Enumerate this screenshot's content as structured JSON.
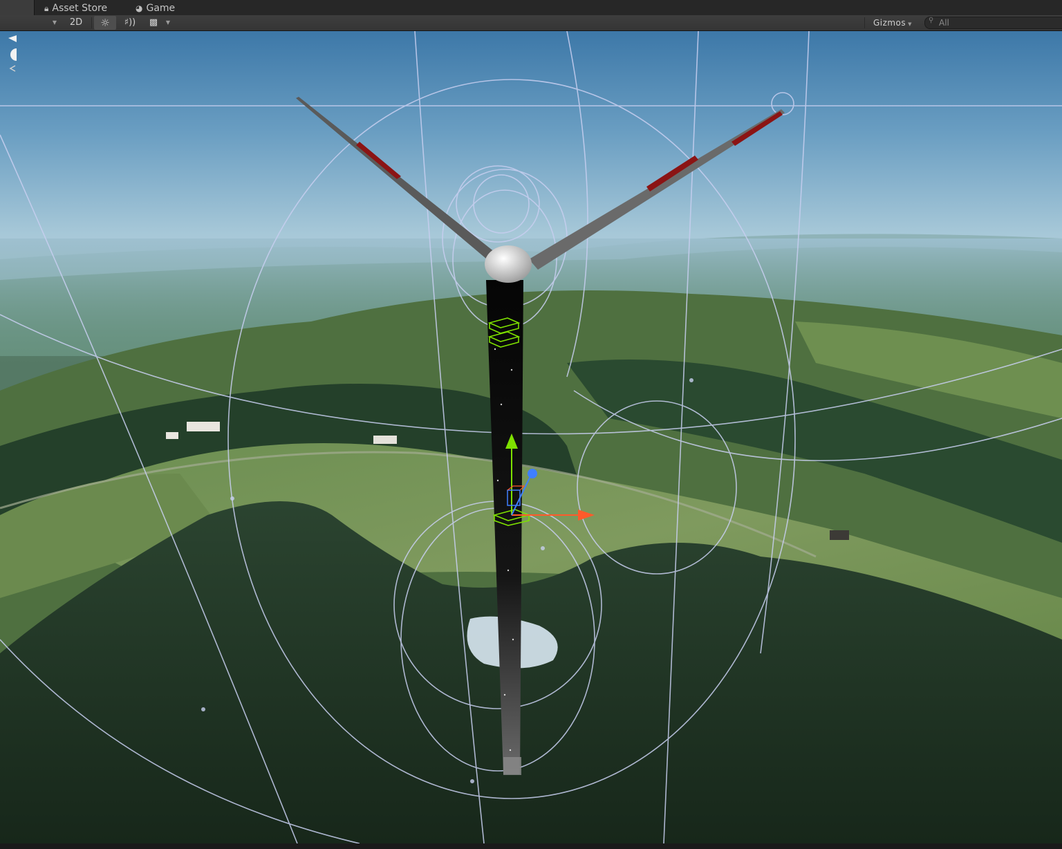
{
  "tabs": {
    "scene_label": "",
    "asset_store_label": "Asset Store",
    "game_label": "Game"
  },
  "toolbar": {
    "mode_2d_label": "2D",
    "gizmos_label": "Gizmos",
    "search_placeholder": "All"
  },
  "icons": {
    "asset_store": "lock-icon",
    "game": "pacman-icon",
    "lighting": "sun-icon",
    "audio": "speaker-icon",
    "effects": "image-icon"
  },
  "colors": {
    "toolbar_bg": "#3a3a3a",
    "tab_bg": "#272727",
    "sky": "#5c90b6",
    "terrain": "#5a7a42",
    "forest": "#1f3324",
    "tower": "#0b0b0b",
    "blade_stripe": "#8b1414",
    "gizmo_wire": "#c8cff0",
    "axis_y": "#7ee000",
    "axis_x": "#ff5a2a",
    "axis_z": "#3f7fff"
  }
}
